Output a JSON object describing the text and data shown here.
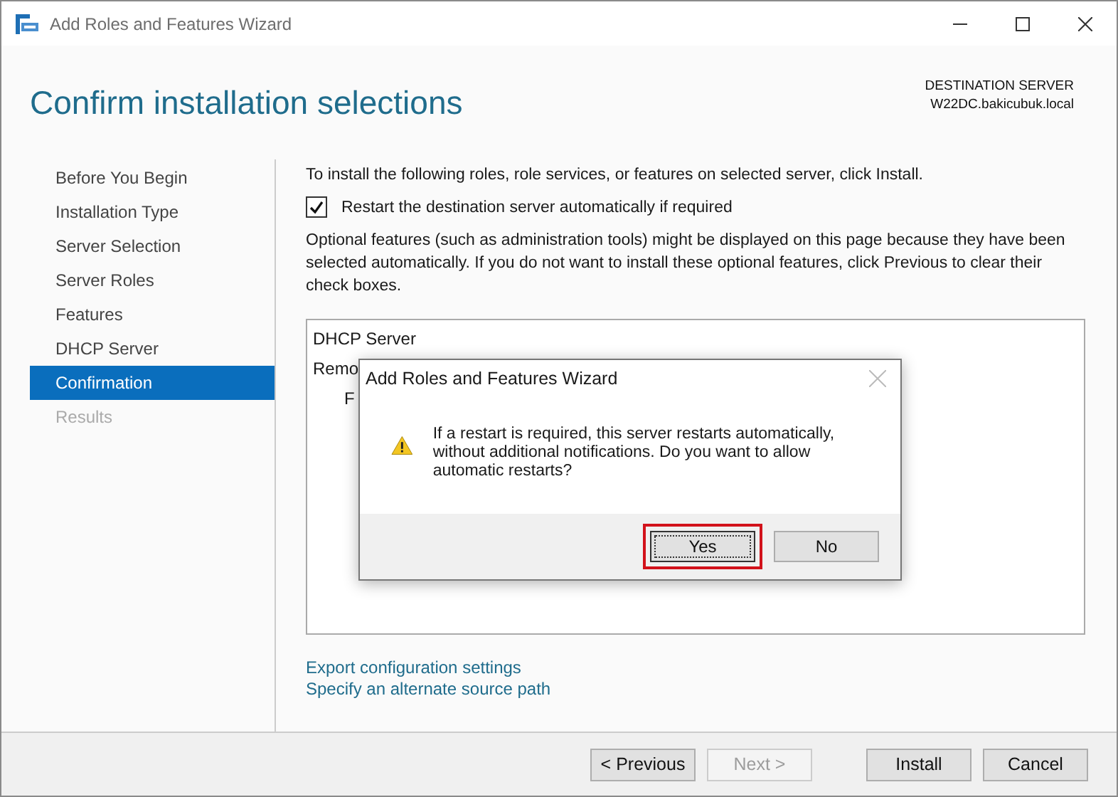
{
  "window": {
    "title": "Add Roles and Features Wizard"
  },
  "header": {
    "title": "Confirm installation selections",
    "destination_label": "DESTINATION SERVER",
    "destination_server": "W22DC.bakicubuk.local"
  },
  "sidebar": {
    "items": [
      {
        "label": "Before You Begin",
        "selected": false,
        "disabled": false
      },
      {
        "label": "Installation Type",
        "selected": false,
        "disabled": false
      },
      {
        "label": "Server Selection",
        "selected": false,
        "disabled": false
      },
      {
        "label": "Server Roles",
        "selected": false,
        "disabled": false
      },
      {
        "label": "Features",
        "selected": false,
        "disabled": false
      },
      {
        "label": "DHCP Server",
        "selected": false,
        "disabled": false
      },
      {
        "label": "Confirmation",
        "selected": true,
        "disabled": false
      },
      {
        "label": "Results",
        "selected": false,
        "disabled": true
      }
    ]
  },
  "content": {
    "intro": "To install the following roles, role services, or features on selected server, click Install.",
    "restart_checkbox": {
      "label": "Restart the destination server automatically if required",
      "checked": true
    },
    "note": "Optional features (such as administration tools) might be displayed on this page because they have been selected automatically. If you do not want to install these optional features, click Previous to clear their check boxes.",
    "selections": [
      {
        "label": "DHCP Server"
      },
      {
        "label": "Remo",
        "children": [
          {
            "label": "F"
          }
        ]
      }
    ],
    "links": [
      "Export configuration settings",
      "Specify an alternate source path"
    ]
  },
  "footer": {
    "buttons": [
      {
        "label": "< Previous",
        "disabled": false
      },
      {
        "label": "Next >",
        "disabled": true
      },
      {
        "label": "Install",
        "disabled": false
      },
      {
        "label": "Cancel",
        "disabled": false
      }
    ]
  },
  "dialog": {
    "title": "Add Roles and Features Wizard",
    "message": "If a restart is required, this server restarts automatically, without additional notifications. Do you want to allow automatic restarts?",
    "buttons": [
      {
        "label": "Yes",
        "focused": true,
        "highlighted": true
      },
      {
        "label": "No",
        "focused": false,
        "highlighted": false
      }
    ]
  }
}
